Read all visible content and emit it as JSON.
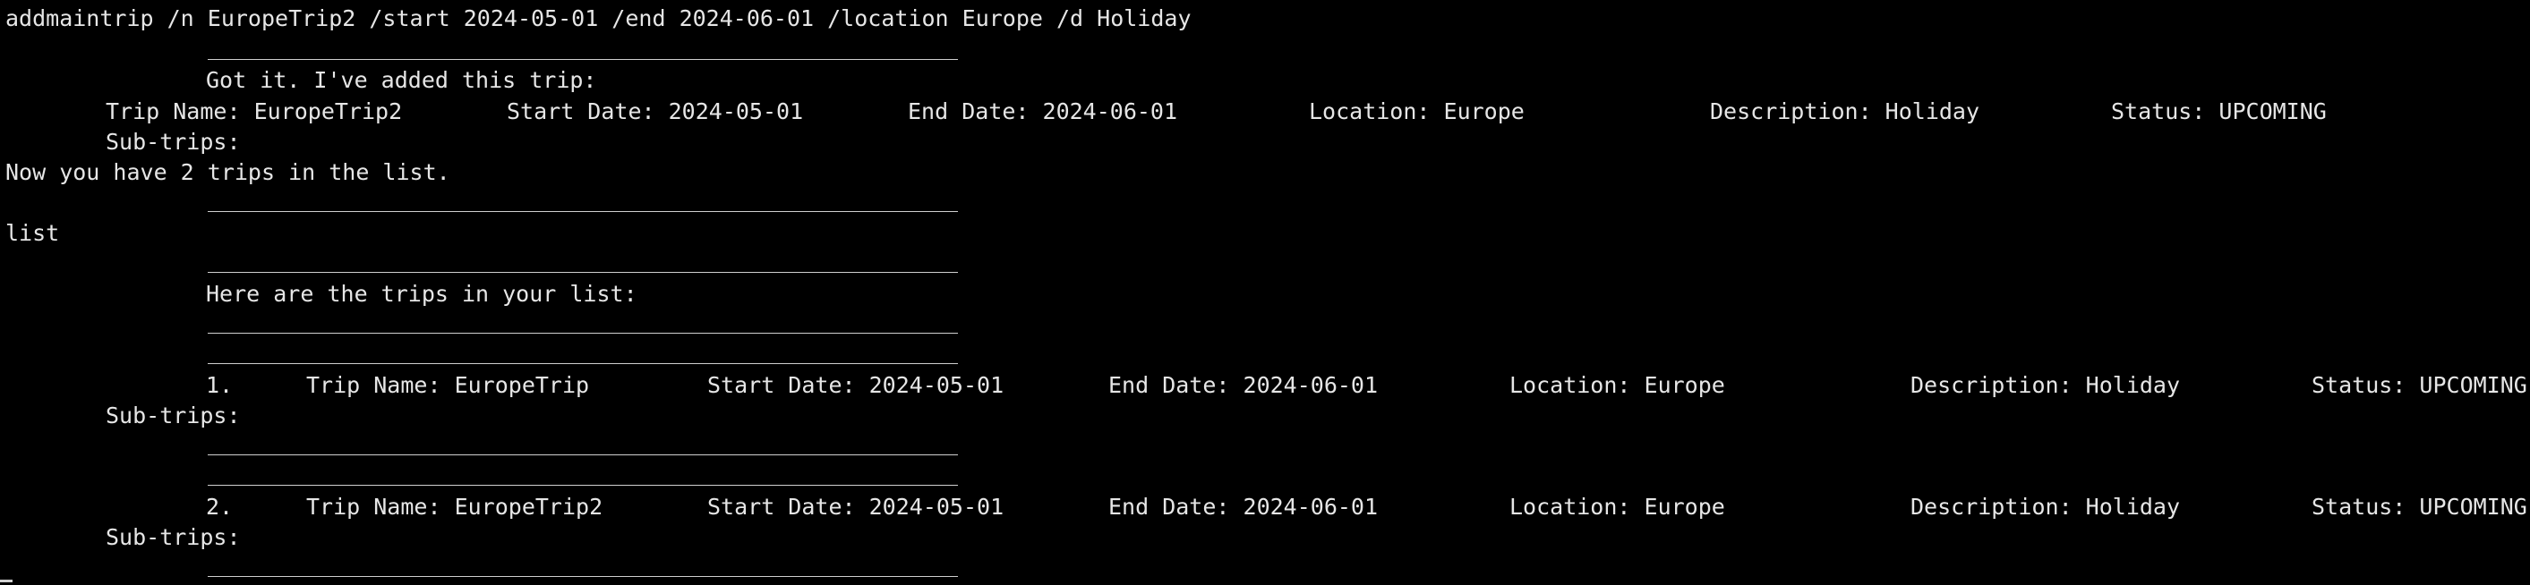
{
  "colors": {
    "background": "#000000",
    "text": "#e6e6e6",
    "divider": "#cfcfcf"
  },
  "command_add": "addmaintrip /n EuropeTrip2 /start 2024-05-01 /end 2024-06-01 /location Europe /d Holiday",
  "added_message": "Got it. I've added this trip:",
  "added_trip": {
    "name": "Trip Name: EuropeTrip2",
    "start": "Start Date: 2024-05-01",
    "end": "End Date: 2024-06-01",
    "location": "Location: Europe",
    "description": "Description: Holiday",
    "status": "Status: UPCOMING",
    "subtrips": "Sub-trips:"
  },
  "count_message": "Now you have 2 trips in the list.",
  "command_list": "list",
  "list_header": "Here are the trips in your list:",
  "trips": [
    {
      "index": "1.",
      "name": "Trip Name: EuropeTrip",
      "start": "Start Date: 2024-05-01",
      "end": "End Date: 2024-06-01",
      "location": "Location: Europe",
      "description": "Description: Holiday",
      "status": "Status: UPCOMING",
      "subtrips": "Sub-trips:"
    },
    {
      "index": "2.",
      "name": "Trip Name: EuropeTrip2",
      "start": "Start Date: 2024-05-01",
      "end": "End Date: 2024-06-01",
      "location": "Location: Europe",
      "description": "Description: Holiday",
      "status": "Status: UPCOMING",
      "subtrips": "Sub-trips:"
    }
  ]
}
